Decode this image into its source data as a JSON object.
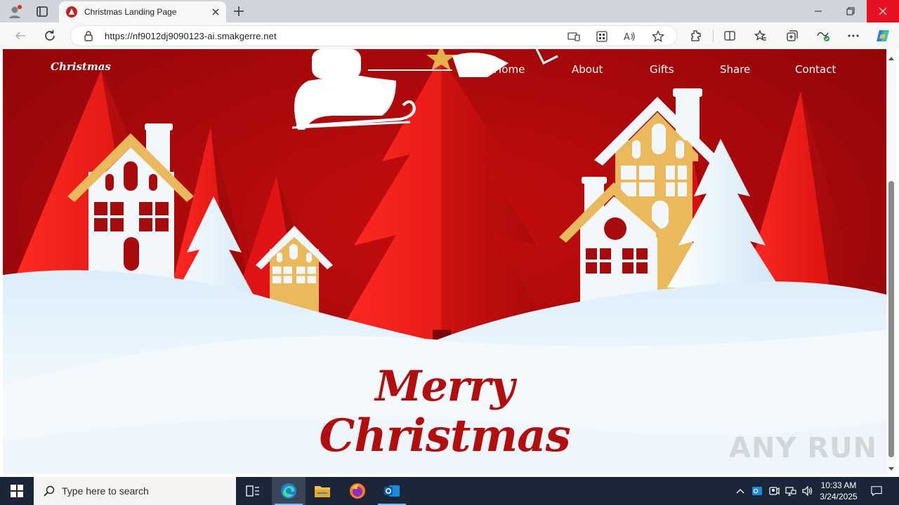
{
  "browser": {
    "tab_title": "Christmas Landing Page",
    "url": "https://nf9012dj9090123-ai.smakgerre.net"
  },
  "page": {
    "brand": "Christmas",
    "nav": [
      "Home",
      "About",
      "Gifts",
      "Share",
      "Contact"
    ],
    "headline_line1": "Merry",
    "headline_line2": "Christmas",
    "watermark": "ANY RUN"
  },
  "taskbar": {
    "search_placeholder": "Type here to search",
    "time": "10:33 AM",
    "date": "3/24/2025"
  },
  "colors": {
    "sky_dark": "#8f0608",
    "sky": "#b50a0c",
    "tree_red": "#e01010",
    "snow": "#e8f4fc",
    "house_white": "#f2f7fb",
    "house_gold": "#e9b95c",
    "headline": "#b30e0e",
    "taskbar": "#1b2738",
    "close_red": "#e81123"
  },
  "icons": [
    "profile-icon",
    "tab-actions-icon",
    "edge-favicon",
    "close-tab-icon",
    "new-tab-icon",
    "back-icon",
    "refresh-icon",
    "lock-icon",
    "app-available-icon",
    "extension-grid-icon",
    "read-aloud-icon",
    "favorite-star-icon",
    "extensions-icon",
    "split-screen-icon",
    "favorites-icon",
    "collections-icon",
    "performance-icon",
    "more-icon",
    "copilot-icon",
    "windows-start-icon",
    "search-icon",
    "task-view-icon",
    "edge-icon",
    "file-explorer-icon",
    "firefox-icon",
    "outlook-icon",
    "show-hidden-icon",
    "outlook-tray-icon",
    "meet-icon",
    "network-icon",
    "volume-icon",
    "notifications-icon"
  ]
}
